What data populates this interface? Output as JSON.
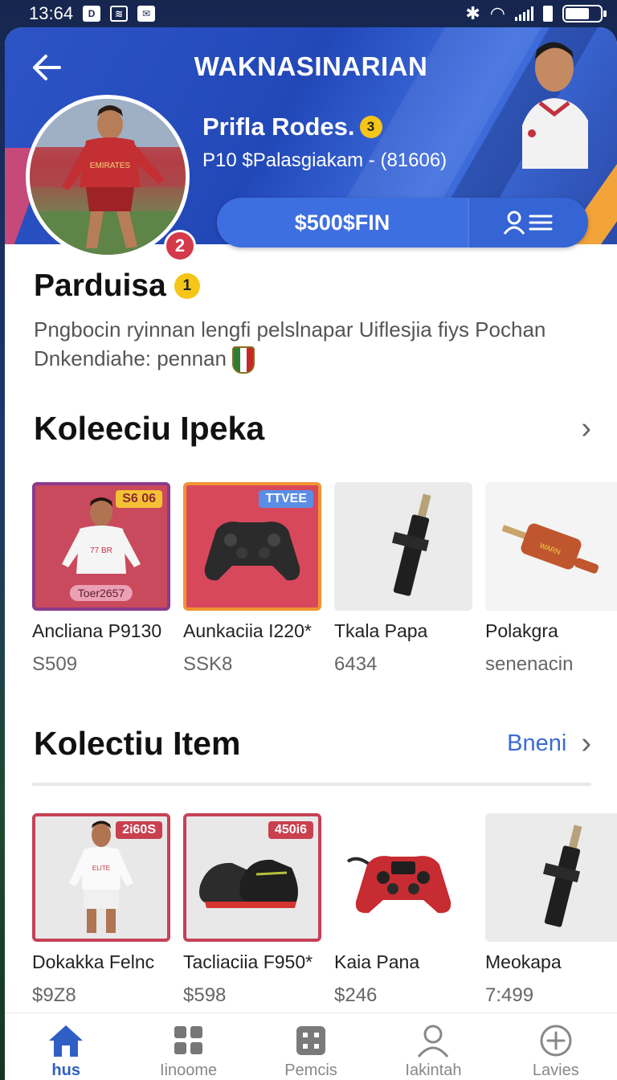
{
  "status_bar": {
    "time": "13:64"
  },
  "header": {
    "title": "WAKNASINARIAN",
    "profile_name": "Prifla Rodes.",
    "profile_badge": "3",
    "profile_sub": "P10 $Palasgiakam - (81606)",
    "balance_label": "$500$FIN",
    "avatar_badge": "2"
  },
  "profile": {
    "name": "Parduisa",
    "name_badge": "1",
    "bio_line1": "Pngbocin ryinnan lengfi pelslnapar Uiflesjia fiys Pochan",
    "bio_line2": "Dnkendiahe: pennan"
  },
  "section1": {
    "title": "Koleeciu Ipeka",
    "items": [
      {
        "title": "Ancliana P9130",
        "price": "S509",
        "tag": "S6 06",
        "name_tag": "Toer2657",
        "icon": "player-card-icon"
      },
      {
        "title": "Aunkaciia I220*",
        "price": "SSK8",
        "tag": "TTVEE",
        "icon": "gamepad-icon"
      },
      {
        "title": "Tkala Papa",
        "price": "6434",
        "icon": "tool-icon"
      },
      {
        "title": "Polakgra",
        "price": "senenacin",
        "icon": "device-icon"
      }
    ]
  },
  "section2": {
    "title": "Kolectiu Item",
    "see_all": "Bneni",
    "items": [
      {
        "title": "Dokakka Felnc",
        "price": "$9Z8",
        "tag": "2i60S",
        "icon": "player-card-icon"
      },
      {
        "title": "Tacliaciia F950*",
        "price": "$598",
        "tag": "450i6",
        "icon": "boots-icon"
      },
      {
        "title": "Kaia Pana",
        "price": "$246",
        "icon": "gamepad-icon"
      },
      {
        "title": "Meokapa",
        "price": "7:499",
        "icon": "tool-icon"
      }
    ]
  },
  "nav": [
    {
      "label": "hus",
      "icon": "home-icon",
      "active": true
    },
    {
      "label": "Iinoome",
      "icon": "grid-icon",
      "active": false
    },
    {
      "label": "Pemcis",
      "icon": "box-icon",
      "active": false
    },
    {
      "label": "Iakintah",
      "icon": "user-icon",
      "active": false
    },
    {
      "label": "Lavies",
      "icon": "add-circle-icon",
      "active": false
    }
  ],
  "colors": {
    "primary": "#2d54c6",
    "accent_gold": "#f5c518",
    "badge_red": "#d33a4a",
    "link_blue": "#3a6bd3"
  }
}
